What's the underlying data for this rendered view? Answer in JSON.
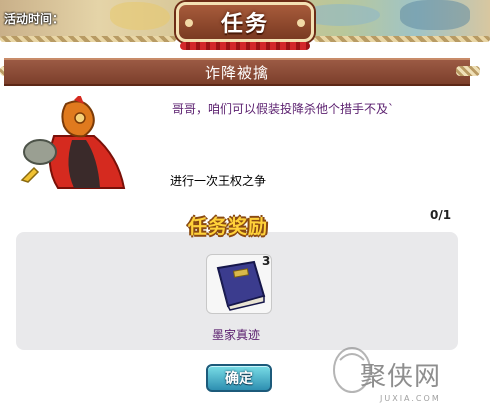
{
  "header": {
    "activity_time_label": "活动时间：",
    "title": "任务"
  },
  "quest": {
    "name": "诈降被擒",
    "dialogue": "哥哥，咱们可以假装投降杀他个措手不及`",
    "description": "进行一次王权之争",
    "progress": "0/1"
  },
  "reward": {
    "title": "任务奖励",
    "items": [
      {
        "name": "墨家真迹",
        "count": "3",
        "icon": "book-icon"
      }
    ]
  },
  "actions": {
    "confirm_label": "确定"
  },
  "watermark": {
    "text": "聚侠网",
    "url": "JUXIA.COM"
  },
  "colors": {
    "banner": "#8a4a33",
    "dialogue_text": "#5a1e6e",
    "reward_title": "#ffd23a",
    "confirm_button": "#2e8fb1"
  }
}
